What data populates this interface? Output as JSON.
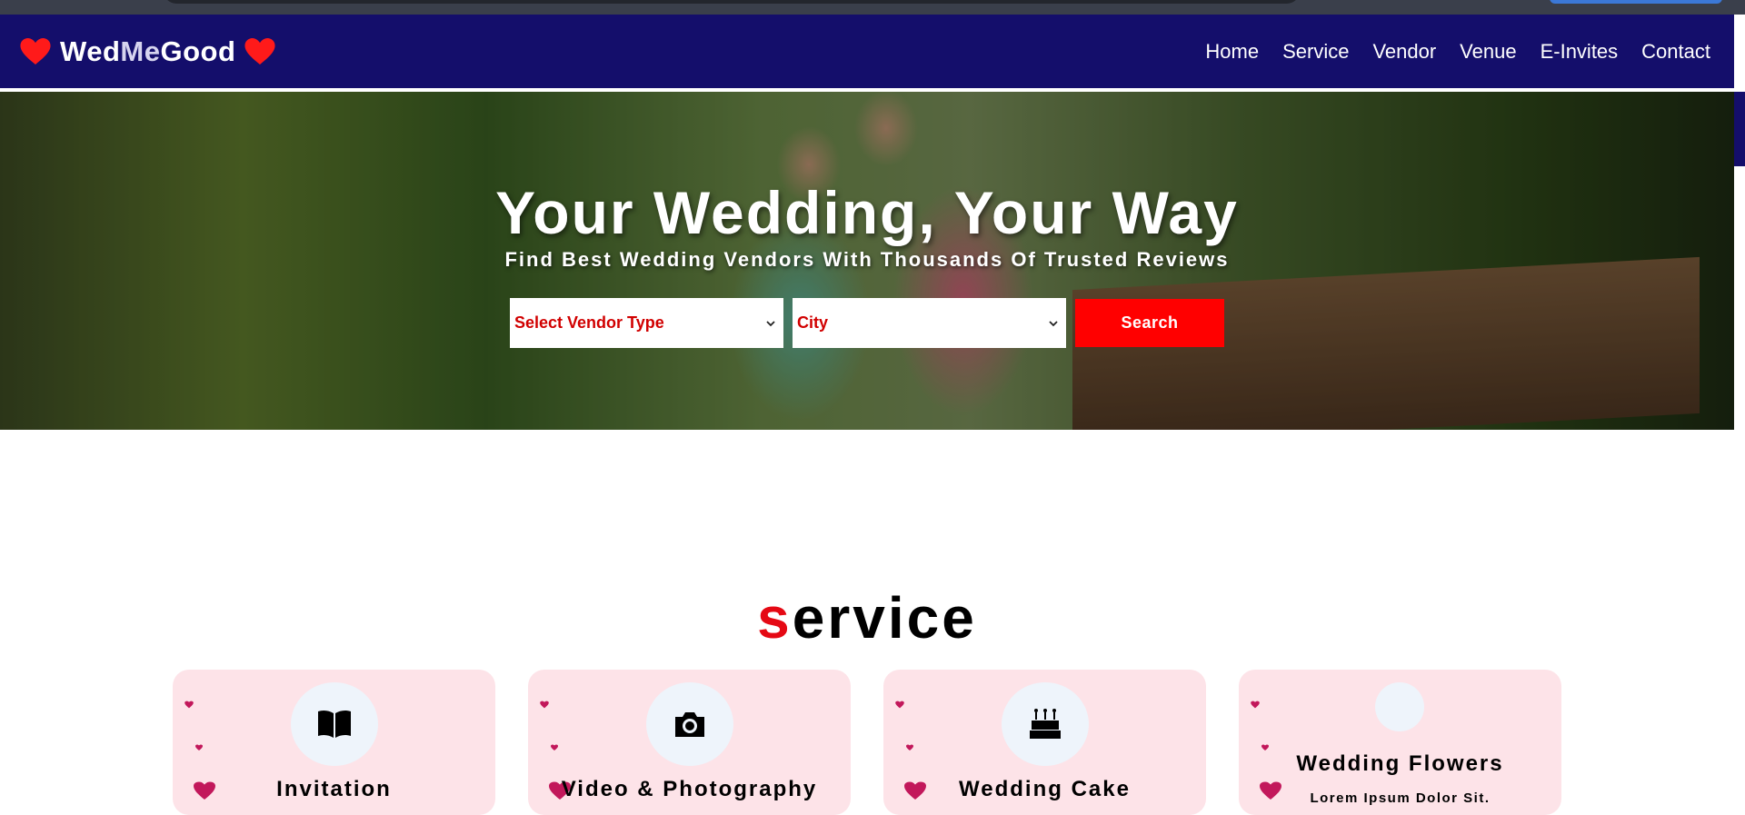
{
  "brand": {
    "part1": "Wed",
    "part2": "Me",
    "part3": "Good"
  },
  "nav": {
    "items": [
      "Home",
      "Service",
      "Vendor",
      "Venue",
      "E-Invites",
      "Contact"
    ]
  },
  "hero": {
    "headline": "Your Wedding, Your Way",
    "tagline": "Find Best Wedding Vendors With Thousands Of Trusted Reviews",
    "vendor_select": "Select Vendor Type",
    "city_select": "City",
    "search_label": "Search"
  },
  "service": {
    "title_first": "s",
    "title_rest": "ervice",
    "cards": [
      {
        "title": "Invitation",
        "icon": "book-icon"
      },
      {
        "title": "Video & Photography",
        "icon": "camera-icon"
      },
      {
        "title": "Wedding Cake",
        "icon": "cake-icon"
      },
      {
        "title": "Wedding Flowers",
        "desc": "Lorem Ipsum Dolor Sit.",
        "icon": "flower-icon"
      }
    ]
  },
  "colors": {
    "nav_bg": "#140e6b",
    "accent_red": "#ff0000",
    "card_bg": "#fde3e8"
  }
}
